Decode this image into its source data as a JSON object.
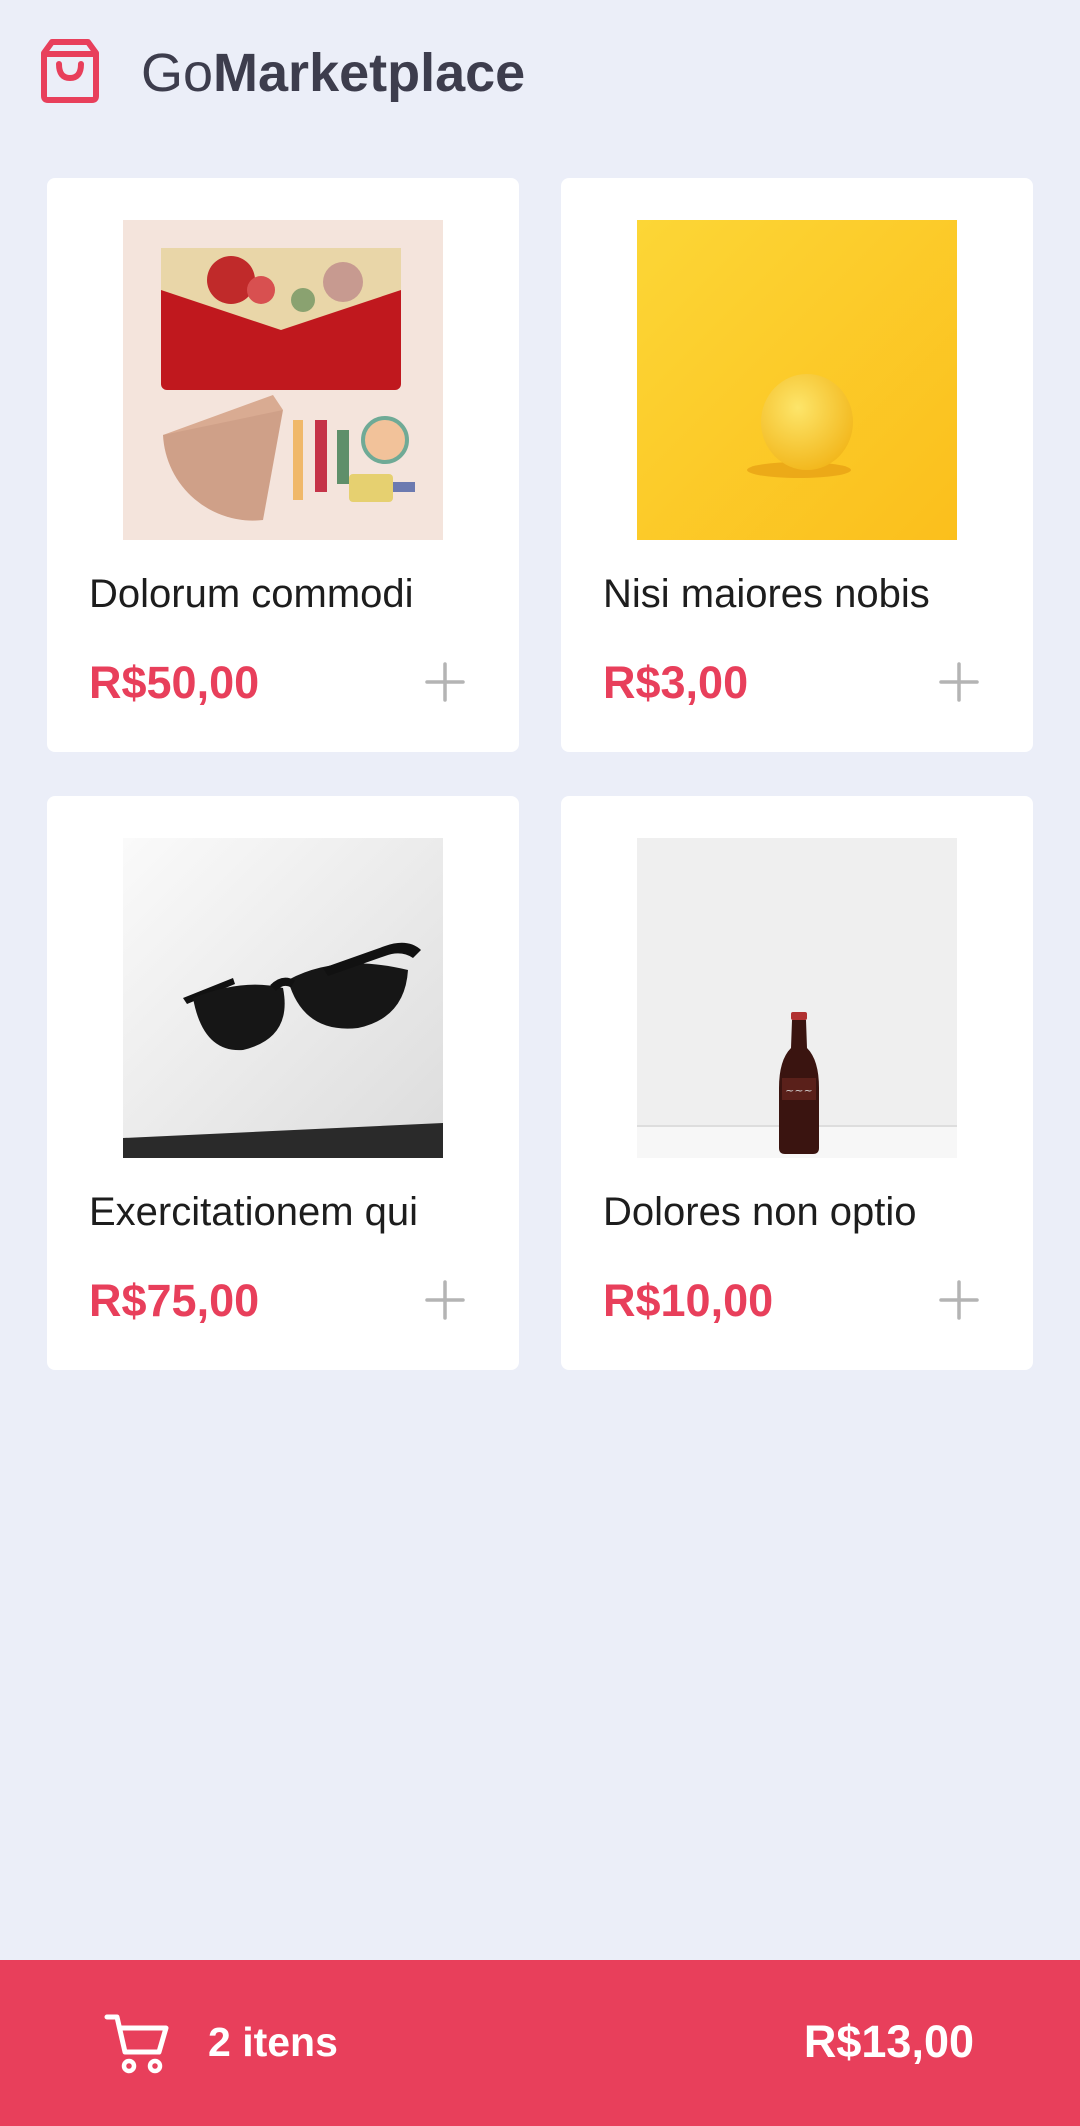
{
  "header": {
    "brand_prefix": "Go",
    "brand_main": "Marketplace",
    "logo_icon": "shopping-bag-icon"
  },
  "colors": {
    "background": "#ebeef8",
    "accent": "#e83f5b",
    "brand_text": "#3d3d4d"
  },
  "products": [
    {
      "title": "Dolorum commodi",
      "price": "R$50,00",
      "image": "purse-and-cosmetics-photo"
    },
    {
      "title": "Nisi maiores nobis",
      "price": "R$3,00",
      "image": "lemon-on-yellow-photo"
    },
    {
      "title": "Exercitationem qui",
      "price": "R$75,00",
      "image": "sunglasses-photo"
    },
    {
      "title": "Dolores non optio",
      "price": "R$10,00",
      "image": "soda-bottle-photo"
    }
  ],
  "cart": {
    "count_label": "2 itens",
    "total": "R$13,00",
    "icon": "shopping-cart-icon"
  }
}
